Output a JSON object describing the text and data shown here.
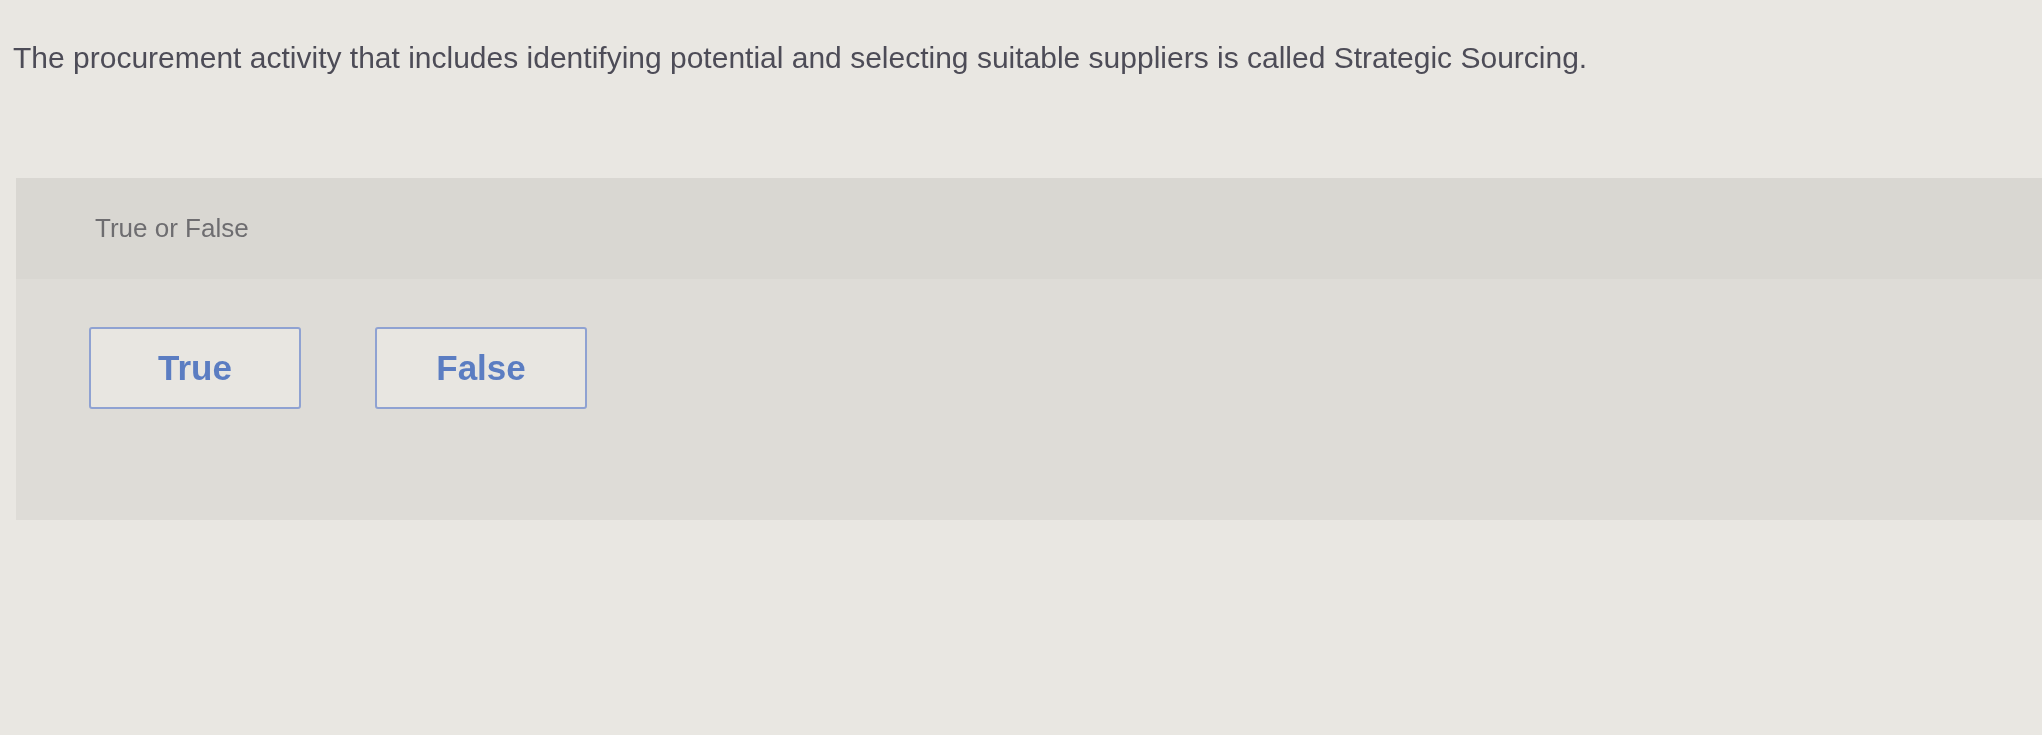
{
  "question": {
    "text": "The procurement activity that includes identifying potential and selecting suitable suppliers is called Strategic Sourcing."
  },
  "answer_panel": {
    "prompt": "True or False",
    "options": [
      {
        "label": "True",
        "selected": false
      },
      {
        "label": "False",
        "selected": false
      }
    ]
  }
}
